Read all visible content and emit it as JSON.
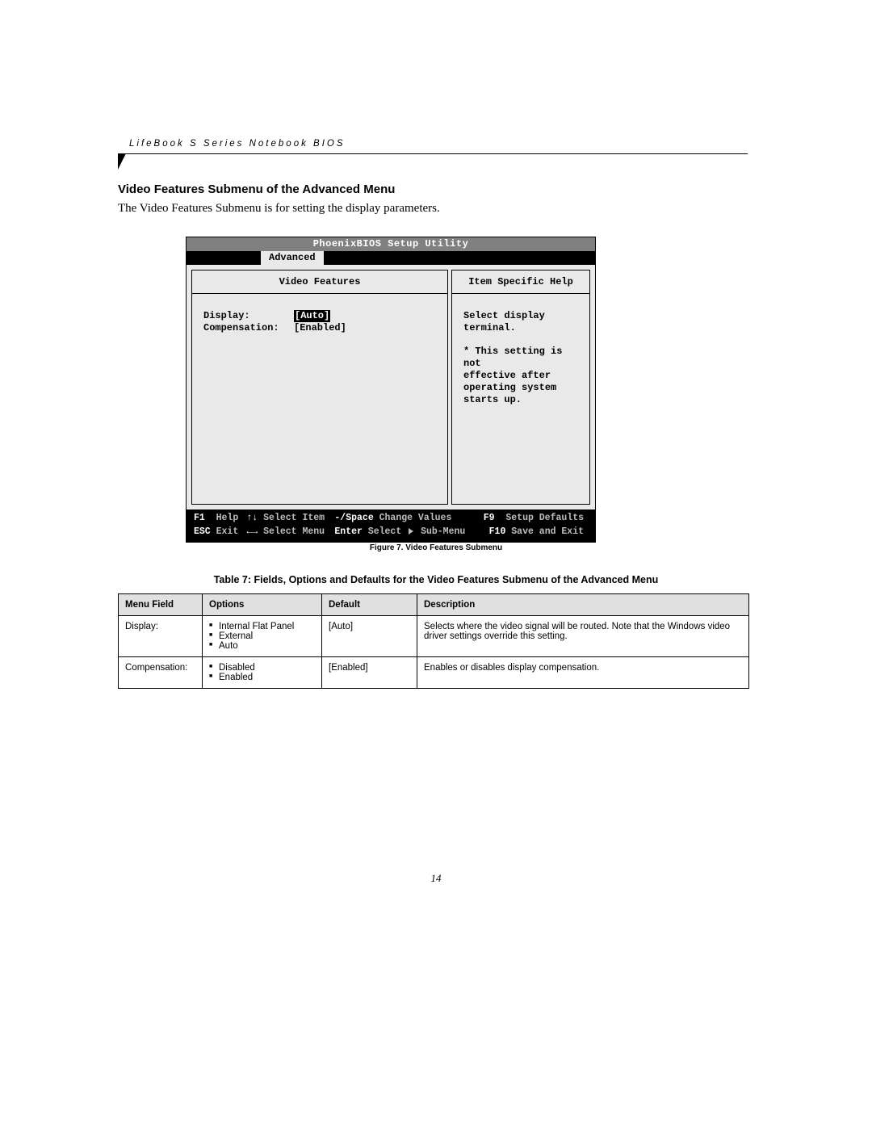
{
  "header": {
    "running_head": "LifeBook S Series Notebook BIOS"
  },
  "section": {
    "title": "Video Features Submenu of the Advanced Menu",
    "intro": "The Video Features Submenu is for setting the display parameters."
  },
  "bios": {
    "title": "PhoenixBIOS Setup Utility",
    "active_tab": "Advanced",
    "left_heading": "Video Features",
    "right_heading": "Item Specific Help",
    "rows": [
      {
        "label": "Display:",
        "value": "[Auto]",
        "selected": true
      },
      {
        "label": "Compensation:",
        "value": "[Enabled]",
        "selected": false
      }
    ],
    "help": {
      "line1": "Select display terminal.",
      "line2": "* This setting is not",
      "line3": "effective after",
      "line4": "operating system",
      "line5": "starts up."
    },
    "footer": {
      "f1_key": "F1",
      "f1_label": "Help",
      "updown_key": "↑↓",
      "updown_label": "Select Item",
      "pm_key": "-/Space",
      "pm_label": "Change Values",
      "f9_key": "F9",
      "f9_label": "Setup Defaults",
      "esc_key": "ESC",
      "esc_label": "Exit",
      "lr_key": "←→",
      "lr_label": "Select Menu",
      "enter_key": "Enter",
      "enter_label_pre": "Select",
      "enter_label_post": "Sub-Menu",
      "f10_key": "F10",
      "f10_label": "Save and Exit"
    }
  },
  "figure_caption": "Figure 7.   Video Features Submenu",
  "table_caption": "Table 7: Fields, Options and Defaults for the Video Features Submenu of the Advanced Menu",
  "table": {
    "headers": [
      "Menu Field",
      "Options",
      "Default",
      "Description"
    ],
    "rows": [
      {
        "field": "Display:",
        "options": [
          "Internal Flat Panel",
          "External",
          "Auto"
        ],
        "default": "[Auto]",
        "description": "Selects where the video signal will be routed. Note that the Windows video driver settings override this setting."
      },
      {
        "field": "Compensation:",
        "options": [
          "Disabled",
          "Enabled"
        ],
        "default": "[Enabled]",
        "description": "Enables or disables display compensation."
      }
    ]
  },
  "page_number": "14"
}
